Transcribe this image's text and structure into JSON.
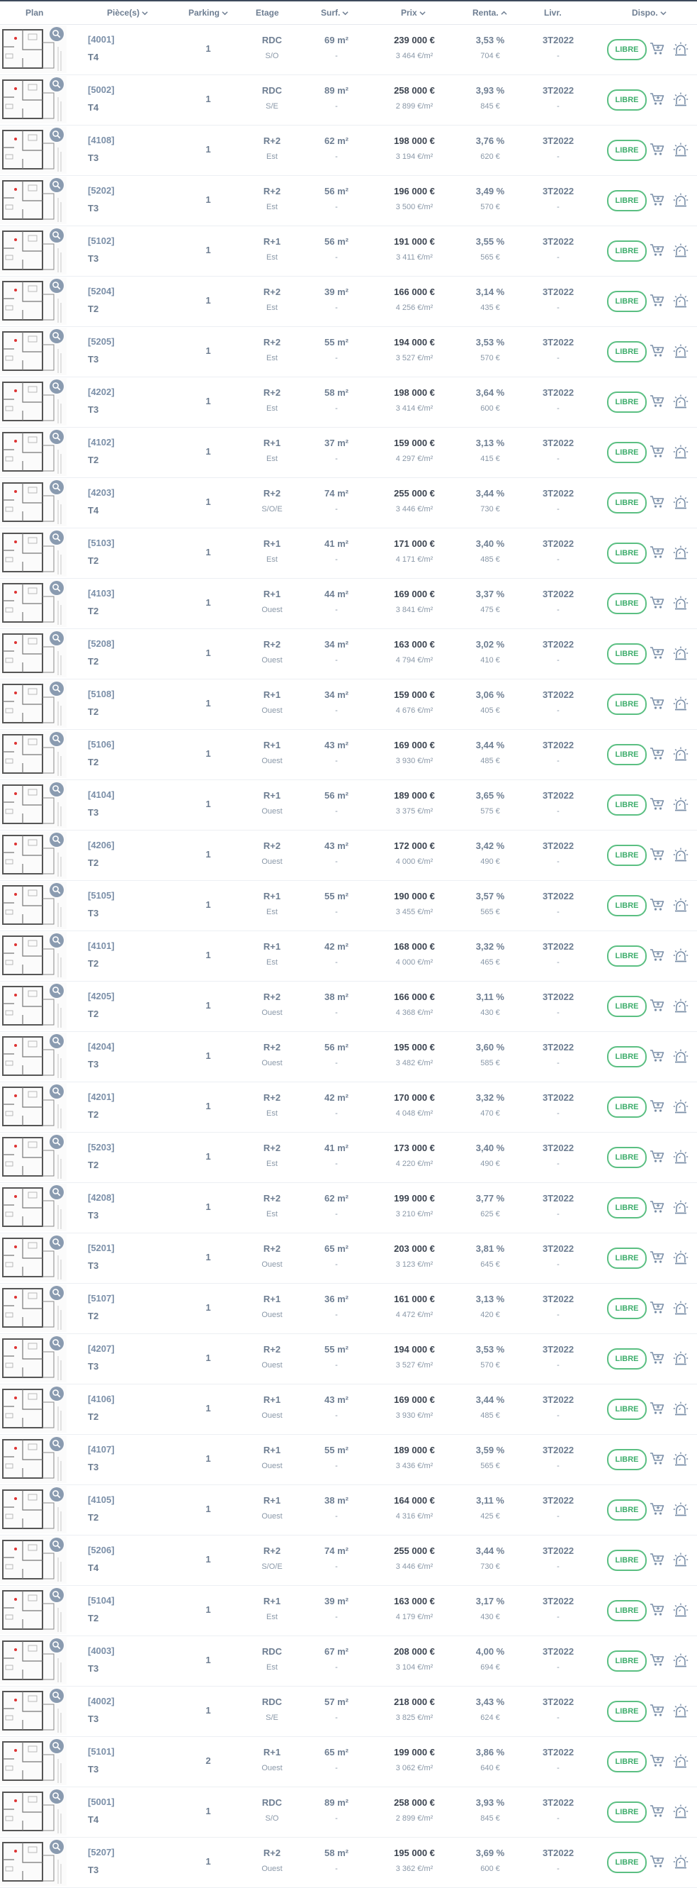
{
  "header": {
    "plan": "Plan",
    "pieces": "Pièce(s)",
    "parking": "Parking",
    "etage": "Etage",
    "surface": "Surf.",
    "prix": "Prix",
    "rentabilite": "Renta.",
    "livraison": "Livr.",
    "disponibilite": "Dispo."
  },
  "colors": {
    "accent": "#3fae6d",
    "header_text": "#6e7e92",
    "lot_text": "#7b8fa8",
    "price_text": "#3c4450",
    "icon": "#8a9bb0"
  },
  "icons": {
    "plan_zoom": "magnifier-icon",
    "reserve": "cart-plus-icon",
    "alert": "alarm-light-icon",
    "sort": "chevron-down-icon",
    "sort_active": "chevron-up-icon"
  },
  "rows": [
    {
      "lot": "[4001]",
      "type": "T4",
      "parking": "1",
      "etage": "RDC",
      "orientation": "S/O",
      "surface": "69 m²",
      "surface_note": "-",
      "prix": "239 000 €",
      "prix_m2": "3 464 €/m²",
      "renta": "3,53 %",
      "loyer": "704 €",
      "livraison": "3T2022",
      "livraison_note": "-",
      "dispo": "LIBRE"
    },
    {
      "lot": "[5002]",
      "type": "T4",
      "parking": "1",
      "etage": "RDC",
      "orientation": "S/E",
      "surface": "89 m²",
      "surface_note": "-",
      "prix": "258 000 €",
      "prix_m2": "2 899 €/m²",
      "renta": "3,93 %",
      "loyer": "845 €",
      "livraison": "3T2022",
      "livraison_note": "-",
      "dispo": "LIBRE"
    },
    {
      "lot": "[4108]",
      "type": "T3",
      "parking": "1",
      "etage": "R+2",
      "orientation": "Est",
      "surface": "62 m²",
      "surface_note": "-",
      "prix": "198 000 €",
      "prix_m2": "3 194 €/m²",
      "renta": "3,76 %",
      "loyer": "620 €",
      "livraison": "3T2022",
      "livraison_note": "-",
      "dispo": "LIBRE"
    },
    {
      "lot": "[5202]",
      "type": "T3",
      "parking": "1",
      "etage": "R+2",
      "orientation": "Est",
      "surface": "56 m²",
      "surface_note": "-",
      "prix": "196 000 €",
      "prix_m2": "3 500 €/m²",
      "renta": "3,49 %",
      "loyer": "570 €",
      "livraison": "3T2022",
      "livraison_note": "-",
      "dispo": "LIBRE"
    },
    {
      "lot": "[5102]",
      "type": "T3",
      "parking": "1",
      "etage": "R+1",
      "orientation": "Est",
      "surface": "56 m²",
      "surface_note": "-",
      "prix": "191 000 €",
      "prix_m2": "3 411 €/m²",
      "renta": "3,55 %",
      "loyer": "565 €",
      "livraison": "3T2022",
      "livraison_note": "-",
      "dispo": "LIBRE"
    },
    {
      "lot": "[5204]",
      "type": "T2",
      "parking": "1",
      "etage": "R+2",
      "orientation": "Est",
      "surface": "39 m²",
      "surface_note": "-",
      "prix": "166 000 €",
      "prix_m2": "4 256 €/m²",
      "renta": "3,14 %",
      "loyer": "435 €",
      "livraison": "3T2022",
      "livraison_note": "-",
      "dispo": "LIBRE"
    },
    {
      "lot": "[5205]",
      "type": "T3",
      "parking": "1",
      "etage": "R+2",
      "orientation": "Est",
      "surface": "55 m²",
      "surface_note": "-",
      "prix": "194 000 €",
      "prix_m2": "3 527 €/m²",
      "renta": "3,53 %",
      "loyer": "570 €",
      "livraison": "3T2022",
      "livraison_note": "-",
      "dispo": "LIBRE"
    },
    {
      "lot": "[4202]",
      "type": "T3",
      "parking": "1",
      "etage": "R+2",
      "orientation": "Est",
      "surface": "58 m²",
      "surface_note": "-",
      "prix": "198 000 €",
      "prix_m2": "3 414 €/m²",
      "renta": "3,64 %",
      "loyer": "600 €",
      "livraison": "3T2022",
      "livraison_note": "-",
      "dispo": "LIBRE"
    },
    {
      "lot": "[4102]",
      "type": "T2",
      "parking": "1",
      "etage": "R+1",
      "orientation": "Est",
      "surface": "37 m²",
      "surface_note": "-",
      "prix": "159 000 €",
      "prix_m2": "4 297 €/m²",
      "renta": "3,13 %",
      "loyer": "415 €",
      "livraison": "3T2022",
      "livraison_note": "-",
      "dispo": "LIBRE"
    },
    {
      "lot": "[4203]",
      "type": "T4",
      "parking": "1",
      "etage": "R+2",
      "orientation": "S/O/E",
      "surface": "74 m²",
      "surface_note": "-",
      "prix": "255 000 €",
      "prix_m2": "3 446 €/m²",
      "renta": "3,44 %",
      "loyer": "730 €",
      "livraison": "3T2022",
      "livraison_note": "-",
      "dispo": "LIBRE"
    },
    {
      "lot": "[5103]",
      "type": "T2",
      "parking": "1",
      "etage": "R+1",
      "orientation": "Est",
      "surface": "41 m²",
      "surface_note": "-",
      "prix": "171 000 €",
      "prix_m2": "4 171 €/m²",
      "renta": "3,40 %",
      "loyer": "485 €",
      "livraison": "3T2022",
      "livraison_note": "-",
      "dispo": "LIBRE"
    },
    {
      "lot": "[4103]",
      "type": "T2",
      "parking": "1",
      "etage": "R+1",
      "orientation": "Ouest",
      "surface": "44 m²",
      "surface_note": "-",
      "prix": "169 000 €",
      "prix_m2": "3 841 €/m²",
      "renta": "3,37 %",
      "loyer": "475 €",
      "livraison": "3T2022",
      "livraison_note": "-",
      "dispo": "LIBRE"
    },
    {
      "lot": "[5208]",
      "type": "T2",
      "parking": "1",
      "etage": "R+2",
      "orientation": "Ouest",
      "surface": "34 m²",
      "surface_note": "-",
      "prix": "163 000 €",
      "prix_m2": "4 794 €/m²",
      "renta": "3,02 %",
      "loyer": "410 €",
      "livraison": "3T2022",
      "livraison_note": "-",
      "dispo": "LIBRE"
    },
    {
      "lot": "[5108]",
      "type": "T2",
      "parking": "1",
      "etage": "R+1",
      "orientation": "Ouest",
      "surface": "34 m²",
      "surface_note": "-",
      "prix": "159 000 €",
      "prix_m2": "4 676 €/m²",
      "renta": "3,06 %",
      "loyer": "405 €",
      "livraison": "3T2022",
      "livraison_note": "-",
      "dispo": "LIBRE"
    },
    {
      "lot": "[5106]",
      "type": "T2",
      "parking": "1",
      "etage": "R+1",
      "orientation": "Ouest",
      "surface": "43 m²",
      "surface_note": "-",
      "prix": "169 000 €",
      "prix_m2": "3 930 €/m²",
      "renta": "3,44 %",
      "loyer": "485 €",
      "livraison": "3T2022",
      "livraison_note": "-",
      "dispo": "LIBRE"
    },
    {
      "lot": "[4104]",
      "type": "T3",
      "parking": "1",
      "etage": "R+1",
      "orientation": "Ouest",
      "surface": "56 m²",
      "surface_note": "-",
      "prix": "189 000 €",
      "prix_m2": "3 375 €/m²",
      "renta": "3,65 %",
      "loyer": "575 €",
      "livraison": "3T2022",
      "livraison_note": "-",
      "dispo": "LIBRE"
    },
    {
      "lot": "[4206]",
      "type": "T2",
      "parking": "1",
      "etage": "R+2",
      "orientation": "Ouest",
      "surface": "43 m²",
      "surface_note": "-",
      "prix": "172 000 €",
      "prix_m2": "4 000 €/m²",
      "renta": "3,42 %",
      "loyer": "490 €",
      "livraison": "3T2022",
      "livraison_note": "-",
      "dispo": "LIBRE"
    },
    {
      "lot": "[5105]",
      "type": "T3",
      "parking": "1",
      "etage": "R+1",
      "orientation": "Est",
      "surface": "55 m²",
      "surface_note": "-",
      "prix": "190 000 €",
      "prix_m2": "3 455 €/m²",
      "renta": "3,57 %",
      "loyer": "565 €",
      "livraison": "3T2022",
      "livraison_note": "-",
      "dispo": "LIBRE"
    },
    {
      "lot": "[4101]",
      "type": "T2",
      "parking": "1",
      "etage": "R+1",
      "orientation": "Est",
      "surface": "42 m²",
      "surface_note": "-",
      "prix": "168 000 €",
      "prix_m2": "4 000 €/m²",
      "renta": "3,32 %",
      "loyer": "465 €",
      "livraison": "3T2022",
      "livraison_note": "-",
      "dispo": "LIBRE"
    },
    {
      "lot": "[4205]",
      "type": "T2",
      "parking": "1",
      "etage": "R+2",
      "orientation": "Ouest",
      "surface": "38 m²",
      "surface_note": "-",
      "prix": "166 000 €",
      "prix_m2": "4 368 €/m²",
      "renta": "3,11 %",
      "loyer": "430 €",
      "livraison": "3T2022",
      "livraison_note": "-",
      "dispo": "LIBRE"
    },
    {
      "lot": "[4204]",
      "type": "T3",
      "parking": "1",
      "etage": "R+2",
      "orientation": "Ouest",
      "surface": "56 m²",
      "surface_note": "-",
      "prix": "195 000 €",
      "prix_m2": "3 482 €/m²",
      "renta": "3,60 %",
      "loyer": "585 €",
      "livraison": "3T2022",
      "livraison_note": "-",
      "dispo": "LIBRE"
    },
    {
      "lot": "[4201]",
      "type": "T2",
      "parking": "1",
      "etage": "R+2",
      "orientation": "Est",
      "surface": "42 m²",
      "surface_note": "-",
      "prix": "170 000 €",
      "prix_m2": "4 048 €/m²",
      "renta": "3,32 %",
      "loyer": "470 €",
      "livraison": "3T2022",
      "livraison_note": "-",
      "dispo": "LIBRE"
    },
    {
      "lot": "[5203]",
      "type": "T2",
      "parking": "1",
      "etage": "R+2",
      "orientation": "Est",
      "surface": "41 m²",
      "surface_note": "-",
      "prix": "173 000 €",
      "prix_m2": "4 220 €/m²",
      "renta": "3,40 %",
      "loyer": "490 €",
      "livraison": "3T2022",
      "livraison_note": "-",
      "dispo": "LIBRE"
    },
    {
      "lot": "[4208]",
      "type": "T3",
      "parking": "1",
      "etage": "R+2",
      "orientation": "Est",
      "surface": "62 m²",
      "surface_note": "-",
      "prix": "199 000 €",
      "prix_m2": "3 210 €/m²",
      "renta": "3,77 %",
      "loyer": "625 €",
      "livraison": "3T2022",
      "livraison_note": "-",
      "dispo": "LIBRE"
    },
    {
      "lot": "[5201]",
      "type": "T3",
      "parking": "1",
      "etage": "R+2",
      "orientation": "Ouest",
      "surface": "65 m²",
      "surface_note": "-",
      "prix": "203 000 €",
      "prix_m2": "3 123 €/m²",
      "renta": "3,81 %",
      "loyer": "645 €",
      "livraison": "3T2022",
      "livraison_note": "-",
      "dispo": "LIBRE"
    },
    {
      "lot": "[5107]",
      "type": "T2",
      "parking": "1",
      "etage": "R+1",
      "orientation": "Ouest",
      "surface": "36 m²",
      "surface_note": "-",
      "prix": "161 000 €",
      "prix_m2": "4 472 €/m²",
      "renta": "3,13 %",
      "loyer": "420 €",
      "livraison": "3T2022",
      "livraison_note": "-",
      "dispo": "LIBRE"
    },
    {
      "lot": "[4207]",
      "type": "T3",
      "parking": "1",
      "etage": "R+2",
      "orientation": "Ouest",
      "surface": "55 m²",
      "surface_note": "-",
      "prix": "194 000 €",
      "prix_m2": "3 527 €/m²",
      "renta": "3,53 %",
      "loyer": "570 €",
      "livraison": "3T2022",
      "livraison_note": "-",
      "dispo": "LIBRE"
    },
    {
      "lot": "[4106]",
      "type": "T2",
      "parking": "1",
      "etage": "R+1",
      "orientation": "Ouest",
      "surface": "43 m²",
      "surface_note": "-",
      "prix": "169 000 €",
      "prix_m2": "3 930 €/m²",
      "renta": "3,44 %",
      "loyer": "485 €",
      "livraison": "3T2022",
      "livraison_note": "-",
      "dispo": "LIBRE"
    },
    {
      "lot": "[4107]",
      "type": "T3",
      "parking": "1",
      "etage": "R+1",
      "orientation": "Ouest",
      "surface": "55 m²",
      "surface_note": "-",
      "prix": "189 000 €",
      "prix_m2": "3 436 €/m²",
      "renta": "3,59 %",
      "loyer": "565 €",
      "livraison": "3T2022",
      "livraison_note": "-",
      "dispo": "LIBRE"
    },
    {
      "lot": "[4105]",
      "type": "T2",
      "parking": "1",
      "etage": "R+1",
      "orientation": "Ouest",
      "surface": "38 m²",
      "surface_note": "-",
      "prix": "164 000 €",
      "prix_m2": "4 316 €/m²",
      "renta": "3,11 %",
      "loyer": "425 €",
      "livraison": "3T2022",
      "livraison_note": "-",
      "dispo": "LIBRE"
    },
    {
      "lot": "[5206]",
      "type": "T4",
      "parking": "1",
      "etage": "R+2",
      "orientation": "S/O/E",
      "surface": "74 m²",
      "surface_note": "-",
      "prix": "255 000 €",
      "prix_m2": "3 446 €/m²",
      "renta": "3,44 %",
      "loyer": "730 €",
      "livraison": "3T2022",
      "livraison_note": "-",
      "dispo": "LIBRE"
    },
    {
      "lot": "[5104]",
      "type": "T2",
      "parking": "1",
      "etage": "R+1",
      "orientation": "Est",
      "surface": "39 m²",
      "surface_note": "-",
      "prix": "163 000 €",
      "prix_m2": "4 179 €/m²",
      "renta": "3,17 %",
      "loyer": "430 €",
      "livraison": "3T2022",
      "livraison_note": "-",
      "dispo": "LIBRE"
    },
    {
      "lot": "[4003]",
      "type": "T3",
      "parking": "1",
      "etage": "RDC",
      "orientation": "Est",
      "surface": "67 m²",
      "surface_note": "-",
      "prix": "208 000 €",
      "prix_m2": "3 104 €/m²",
      "renta": "4,00 %",
      "loyer": "694 €",
      "livraison": "3T2022",
      "livraison_note": "-",
      "dispo": "LIBRE"
    },
    {
      "lot": "[4002]",
      "type": "T3",
      "parking": "1",
      "etage": "RDC",
      "orientation": "S/E",
      "surface": "57 m²",
      "surface_note": "-",
      "prix": "218 000 €",
      "prix_m2": "3 825 €/m²",
      "renta": "3,43 %",
      "loyer": "624 €",
      "livraison": "3T2022",
      "livraison_note": "-",
      "dispo": "LIBRE"
    },
    {
      "lot": "[5101]",
      "type": "T3",
      "parking": "2",
      "etage": "R+1",
      "orientation": "Ouest",
      "surface": "65 m²",
      "surface_note": "-",
      "prix": "199 000 €",
      "prix_m2": "3 062 €/m²",
      "renta": "3,86 %",
      "loyer": "640 €",
      "livraison": "3T2022",
      "livraison_note": "-",
      "dispo": "LIBRE"
    },
    {
      "lot": "[5001]",
      "type": "T4",
      "parking": "1",
      "etage": "RDC",
      "orientation": "S/O",
      "surface": "89 m²",
      "surface_note": "-",
      "prix": "258 000 €",
      "prix_m2": "2 899 €/m²",
      "renta": "3,93 %",
      "loyer": "845 €",
      "livraison": "3T2022",
      "livraison_note": "-",
      "dispo": "LIBRE"
    },
    {
      "lot": "[5207]",
      "type": "T3",
      "parking": "1",
      "etage": "R+2",
      "orientation": "Ouest",
      "surface": "58 m²",
      "surface_note": "-",
      "prix": "195 000 €",
      "prix_m2": "3 362 €/m²",
      "renta": "3,69 %",
      "loyer": "600 €",
      "livraison": "3T2022",
      "livraison_note": "-",
      "dispo": "LIBRE"
    }
  ]
}
